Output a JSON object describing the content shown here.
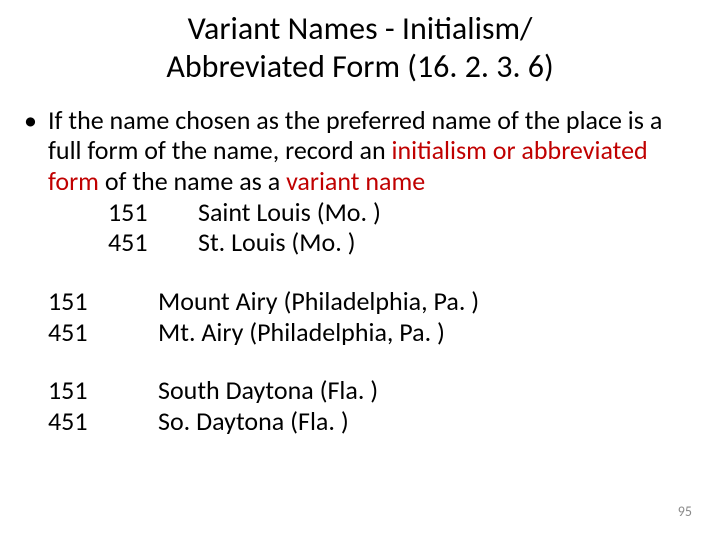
{
  "title_line1": "Variant Names - Initialism/",
  "title_line2": "Abbreviated Form (16. 2. 3. 6)",
  "bullet_dot": "•",
  "bullet_part1": "If the name chosen as the preferred name of the place is a full form of the name, record an ",
  "bullet_part2_red": "initialism or abbreviated form",
  "bullet_part3": " of the name as a ",
  "bullet_part4_red": "variant name",
  "examples": [
    {
      "rows": [
        {
          "code": "151",
          "value": "Saint Louis (Mo. )"
        },
        {
          "code": "451",
          "value": "St. Louis (Mo. )"
        }
      ]
    },
    {
      "rows": [
        {
          "code": "151",
          "value": "Mount Airy (Philadelphia, Pa. )"
        },
        {
          "code": "451",
          "value": "Mt. Airy (Philadelphia, Pa. )"
        }
      ]
    },
    {
      "rows": [
        {
          "code": "151",
          "value": "South Daytona (Fla. )"
        },
        {
          "code": "451",
          "value": "So. Daytona (Fla. )"
        }
      ]
    }
  ],
  "page_number": "95"
}
